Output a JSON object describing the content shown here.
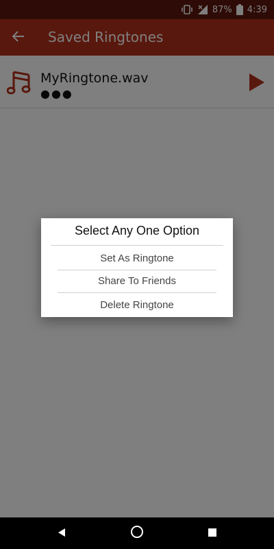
{
  "status_bar": {
    "battery_percent": "87%",
    "time": "4:39",
    "icons": [
      "vibrate-icon",
      "signal-icon",
      "battery-icon"
    ]
  },
  "app_bar": {
    "title": "Saved Ringtones",
    "back_icon": "back-arrow-icon"
  },
  "ringtones": [
    {
      "name": "MyRingtone.wav",
      "more": "●●●",
      "icon": "music-note-icon",
      "play_icon": "play-icon"
    }
  ],
  "dialog": {
    "title": "Select Any One Option",
    "options": [
      {
        "label": "Set As Ringtone"
      },
      {
        "label": "Share To Friends"
      },
      {
        "label": "Delete Ringtone"
      }
    ]
  },
  "nav_bar": {
    "icons": [
      "back-icon",
      "home-icon",
      "recents-icon"
    ]
  },
  "colors": {
    "status_bar": "#5c170d",
    "app_bar": "#b3301a",
    "accent": "#b3301a",
    "overlay": "rgba(0,0,0,0.5)"
  }
}
